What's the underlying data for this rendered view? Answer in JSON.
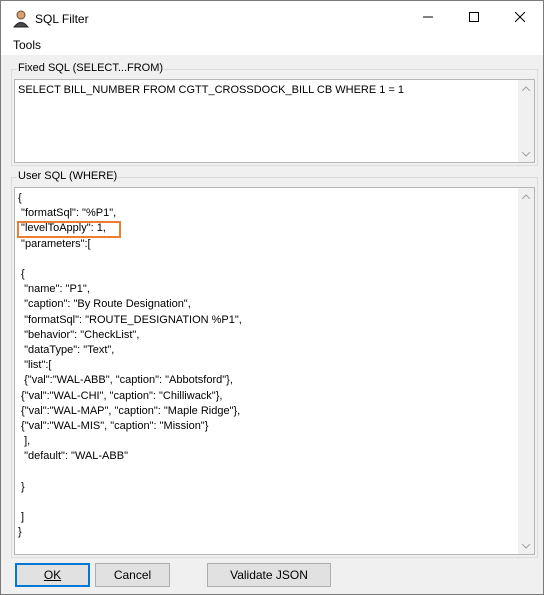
{
  "window": {
    "title": "SQL Filter"
  },
  "menu": {
    "tools": "Tools"
  },
  "fixed_sql": {
    "label": "Fixed SQL (SELECT...FROM)",
    "text": "SELECT BILL_NUMBER FROM CGTT_CROSSDOCK_BILL CB WHERE 1 = 1"
  },
  "user_sql": {
    "label": "User SQL (WHERE)",
    "text": "{\n \"formatSql\": \"%P1\",\n \"levelToApply\": 1,\n \"parameters\":[\n\n {\n  \"name\": \"P1\",\n  \"caption\": \"By Route Designation\",\n  \"formatSql\": \"ROUTE_DESIGNATION %P1\",\n  \"behavior\": \"CheckList\",\n  \"dataType\": \"Text\",\n  \"list\":[\n  {\"val\":\"WAL-ABB\", \"caption\": \"Abbotsford\"},\n {\"val\":\"WAL-CHI\", \"caption\": \"Chilliwack\"},\n {\"val\":\"WAL-MAP\", \"caption\": \"Maple Ridge\"},\n {\"val\":\"WAL-MIS\", \"caption\": \"Mission\"}\n  ],\n  \"default\": \"WAL-ABB\"\n\n }\n\n ]\n}"
  },
  "buttons": {
    "ok": "OK",
    "cancel": "Cancel",
    "validate": "Validate JSON"
  },
  "colors": {
    "highlight": "#ed7d31",
    "accent": "#0078d7"
  }
}
